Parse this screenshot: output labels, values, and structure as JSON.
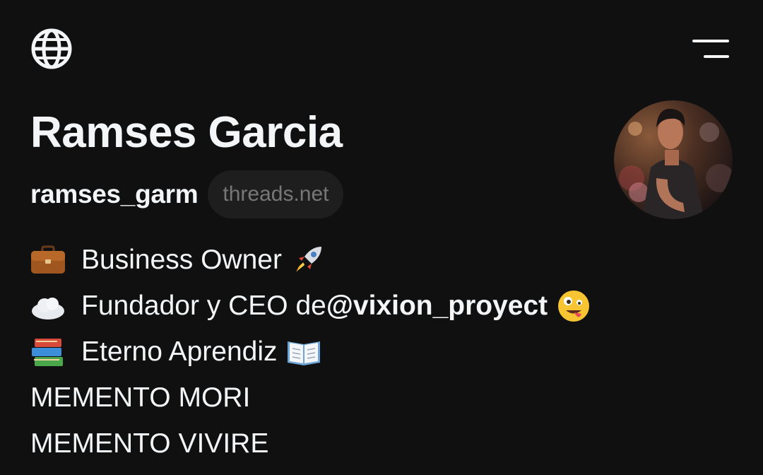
{
  "header": {
    "globe_icon": "globe-icon",
    "menu_icon": "hamburger-menu-icon"
  },
  "profile": {
    "display_name": "Ramses Garcia",
    "username": "ramses_garm",
    "domain_badge": "threads.net",
    "avatar": "profile-photo"
  },
  "bio": {
    "line1": {
      "icon": "briefcase-emoji",
      "text": "Business Owner",
      "trailing_icon": "rocket-emoji"
    },
    "line2": {
      "icon": "cloud-emoji",
      "text": "Fundador y CEO de ",
      "mention": "@vixion_proyect",
      "trailing_icon": "zany-face-emoji"
    },
    "line3": {
      "icon": "books-emoji",
      "text": "Eterno Aprendiz",
      "trailing_icon": "open-book-emoji"
    },
    "line4": "MEMENTO MORI",
    "line5": "MEMENTO VIVIRE"
  },
  "colors": {
    "background": "#101010",
    "text_primary": "#f3f5f7",
    "badge_background": "#1e1e1e",
    "badge_text": "#777777"
  }
}
